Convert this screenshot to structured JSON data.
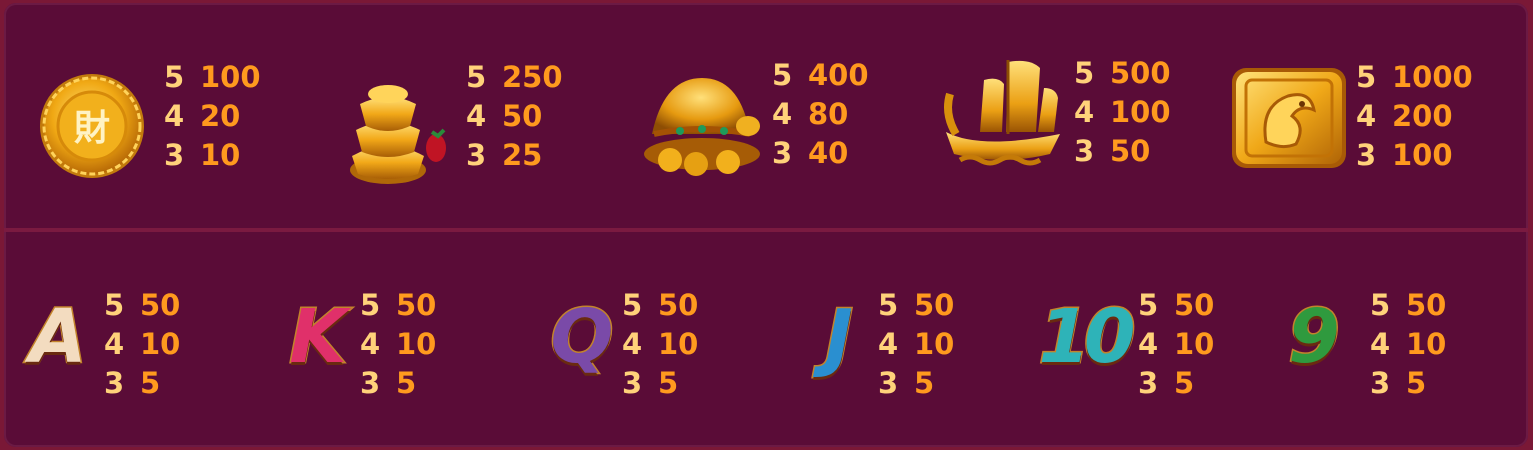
{
  "paytable": {
    "top": [
      {
        "name": "coin",
        "pays": [
          {
            "count": "5",
            "value": "100"
          },
          {
            "count": "4",
            "value": "20"
          },
          {
            "count": "3",
            "value": "10"
          }
        ],
        "glyph": "財"
      },
      {
        "name": "ingots",
        "pays": [
          {
            "count": "5",
            "value": "250"
          },
          {
            "count": "4",
            "value": "50"
          },
          {
            "count": "3",
            "value": "25"
          }
        ]
      },
      {
        "name": "turtle",
        "pays": [
          {
            "count": "5",
            "value": "400"
          },
          {
            "count": "4",
            "value": "80"
          },
          {
            "count": "3",
            "value": "40"
          }
        ]
      },
      {
        "name": "ship",
        "pays": [
          {
            "count": "5",
            "value": "500"
          },
          {
            "count": "4",
            "value": "100"
          },
          {
            "count": "3",
            "value": "50"
          }
        ]
      },
      {
        "name": "fish-tile",
        "pays": [
          {
            "count": "5",
            "value": "1000"
          },
          {
            "count": "4",
            "value": "200"
          },
          {
            "count": "3",
            "value": "100"
          }
        ]
      }
    ],
    "bottom": [
      {
        "name": "A",
        "letter": "A",
        "color": "#f3dcc0",
        "pays": [
          {
            "count": "5",
            "value": "50"
          },
          {
            "count": "4",
            "value": "10"
          },
          {
            "count": "3",
            "value": "5"
          }
        ]
      },
      {
        "name": "K",
        "letter": "K",
        "color": "#e0306a",
        "pays": [
          {
            "count": "5",
            "value": "50"
          },
          {
            "count": "4",
            "value": "10"
          },
          {
            "count": "3",
            "value": "5"
          }
        ]
      },
      {
        "name": "Q",
        "letter": "Q",
        "color": "#7a4aa8",
        "pays": [
          {
            "count": "5",
            "value": "50"
          },
          {
            "count": "4",
            "value": "10"
          },
          {
            "count": "3",
            "value": "5"
          }
        ]
      },
      {
        "name": "J",
        "letter": "J",
        "color": "#2a8fd0",
        "pays": [
          {
            "count": "5",
            "value": "50"
          },
          {
            "count": "4",
            "value": "10"
          },
          {
            "count": "3",
            "value": "5"
          }
        ]
      },
      {
        "name": "10",
        "letter": "10",
        "color": "#2eb3b8",
        "pays": [
          {
            "count": "5",
            "value": "50"
          },
          {
            "count": "4",
            "value": "10"
          },
          {
            "count": "3",
            "value": "5"
          }
        ]
      },
      {
        "name": "9",
        "letter": "9",
        "color": "#2f9a3e",
        "pays": [
          {
            "count": "5",
            "value": "50"
          },
          {
            "count": "4",
            "value": "10"
          },
          {
            "count": "3",
            "value": "5"
          }
        ]
      }
    ]
  },
  "colors": {
    "background": "#5a0c37",
    "count": "#ffd27a",
    "value": "#ff9a1e",
    "gold": "#f0b020"
  }
}
